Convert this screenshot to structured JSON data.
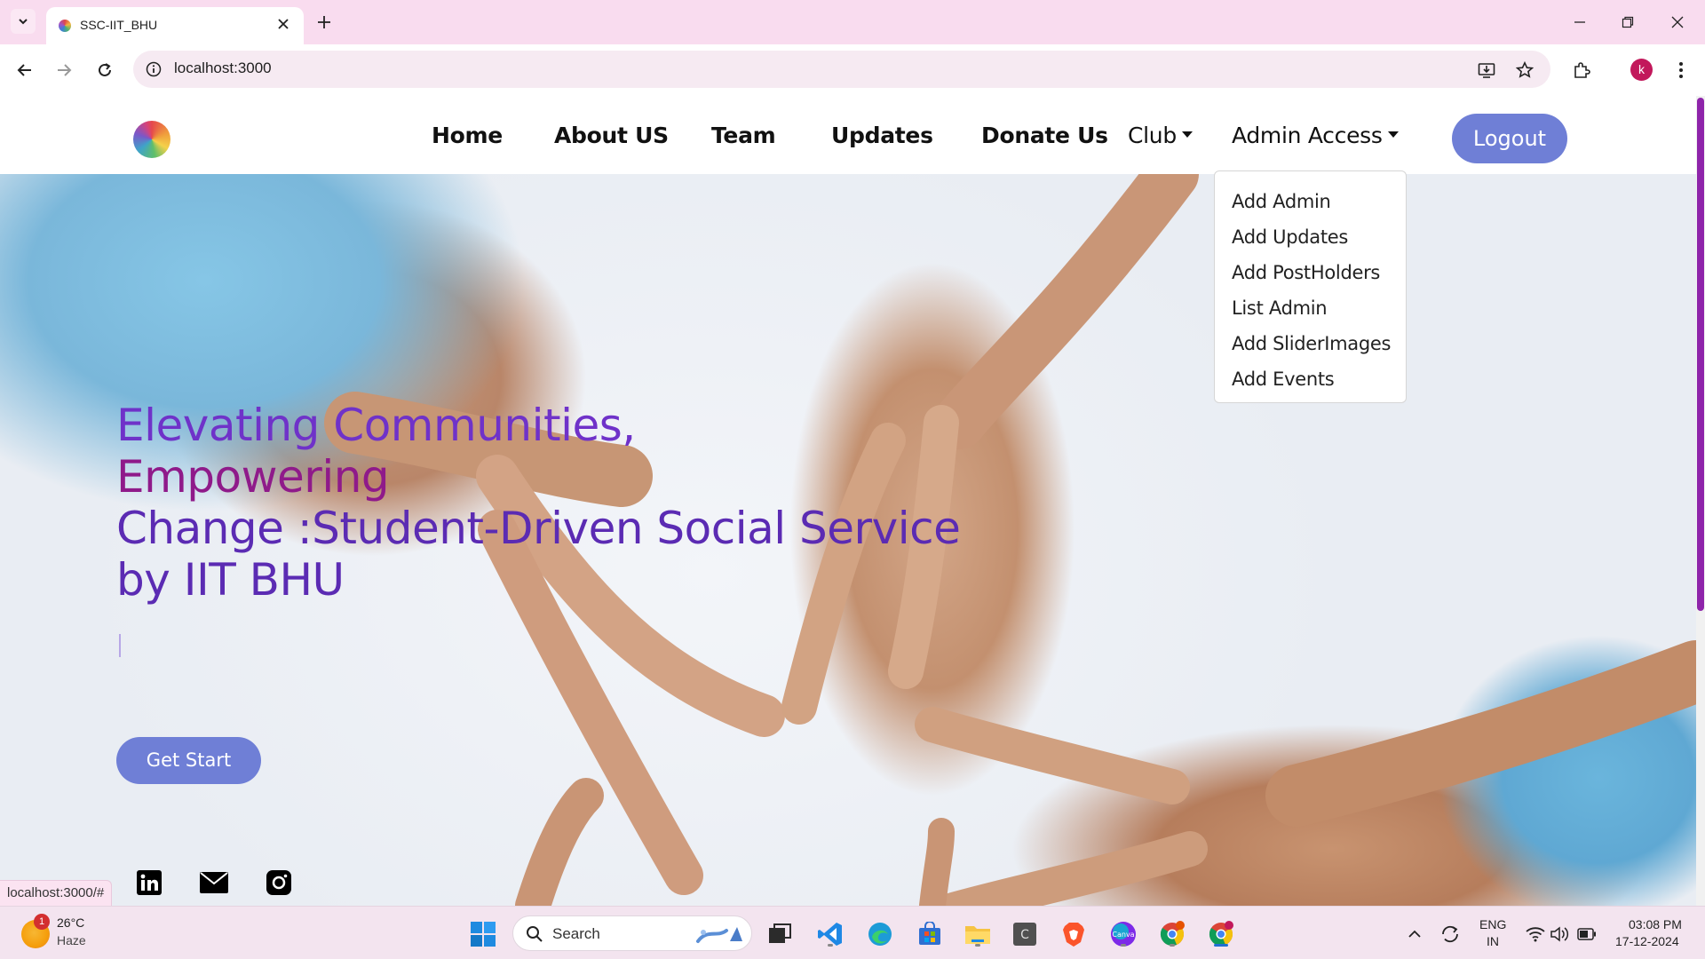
{
  "browser": {
    "tab_title": "SSC-IIT_BHU",
    "url": "localhost:3000",
    "status_url": "localhost:3000/#",
    "profile_initial": "k"
  },
  "navbar": {
    "links": [
      "Home",
      "About US",
      "Team",
      "Updates",
      "Donate Us"
    ],
    "club_label": "Club",
    "admin_label": "Admin Access",
    "logout_label": "Logout"
  },
  "admin_menu": {
    "items": [
      "Add Admin",
      "Add Updates",
      "Add PostHolders",
      "List Admin",
      "Add SliderImages",
      "Add Events"
    ]
  },
  "hero": {
    "line1": "Elevating Communities,",
    "line2": "Empowering",
    "line3": "Change :Student-Driven Social Service",
    "line4": "by IIT BHU",
    "cta_label": "Get Start"
  },
  "social": [
    "linkedin-icon",
    "mail-icon",
    "instagram-icon"
  ],
  "taskbar": {
    "weather_temp": "26°C",
    "weather_condition": "Haze",
    "weather_badge": "1",
    "search_label": "Search",
    "lang_top": "ENG",
    "lang_bottom": "IN",
    "time": "03:08 PM",
    "date": "17-12-2024"
  },
  "colors": {
    "accent_button": "#6f7fd6",
    "hero_purple": "#6f32c9",
    "hero_magenta": "#8f1a8a",
    "tab_strip": "#f9dcef"
  }
}
